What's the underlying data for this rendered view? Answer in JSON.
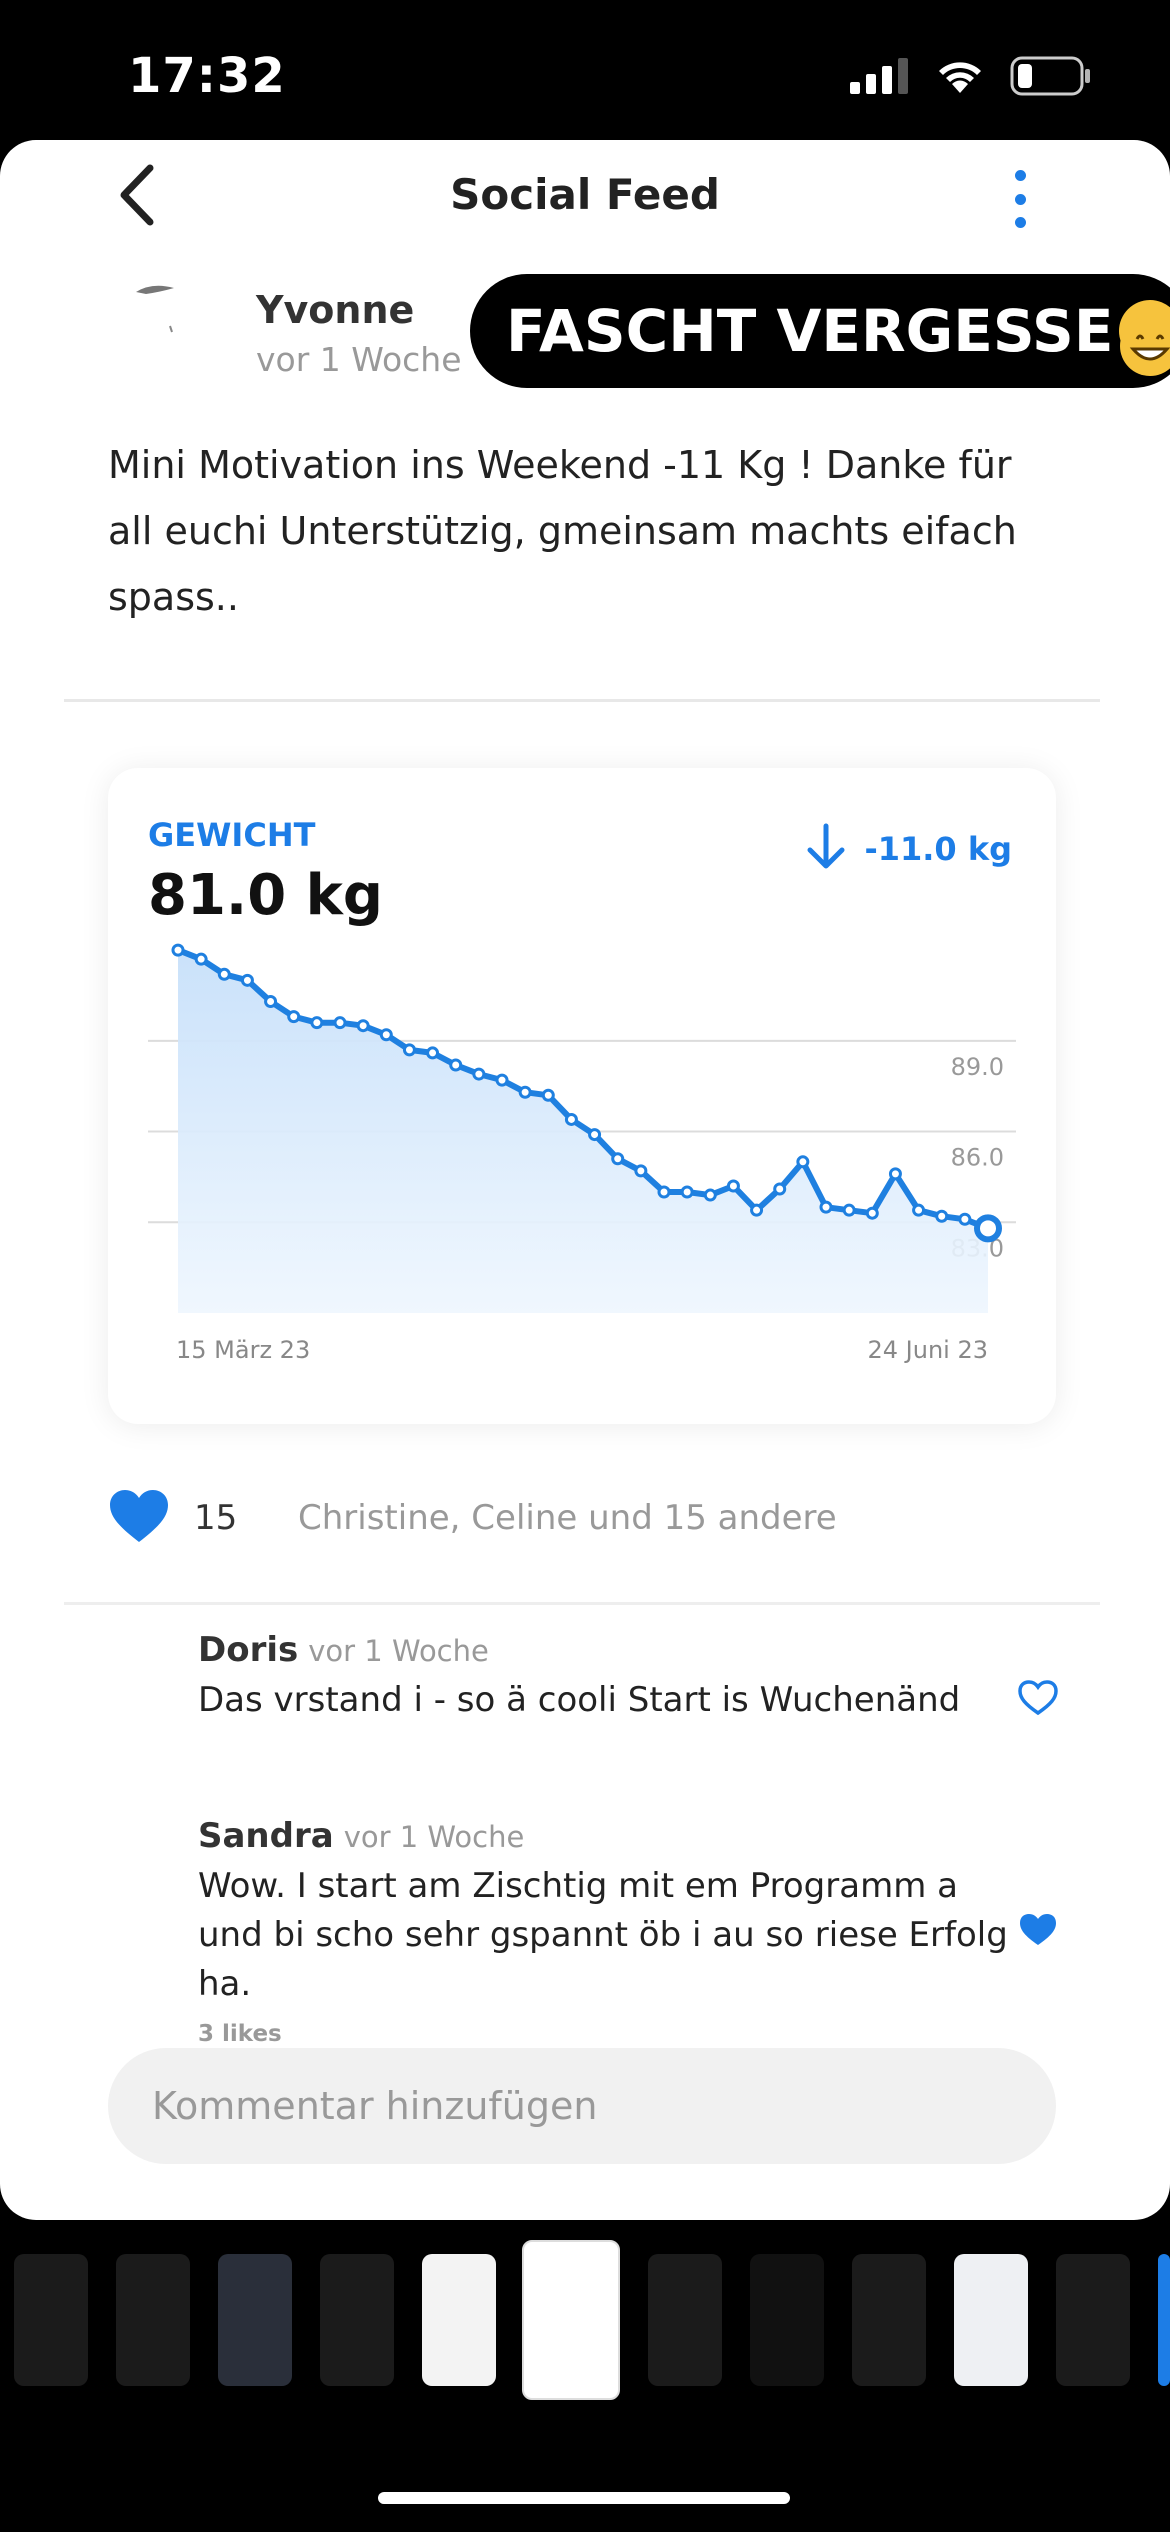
{
  "status": {
    "time": "17:32"
  },
  "nav": {
    "title": "Social Feed"
  },
  "post": {
    "author": "Yvonne",
    "time": "vor 1 Woche",
    "sticker_text": "FASCHT VERGESSE",
    "text": "Mini Motivation ins Weekend -11 Kg ! Danke  für all euchi Unterstützig, gmeinsam machts eifach spass.."
  },
  "weight_card": {
    "label": "GEWICHT",
    "current": "81.0 kg",
    "change": "-11.0 kg"
  },
  "chart_data": {
    "type": "area",
    "x_start_label": "15 März 23",
    "x_end_label": "24 Juni 23",
    "gridline_labels": [
      "89.0",
      "86.0",
      "83.0"
    ],
    "gridlines": [
      89.0,
      86.0,
      83.0
    ],
    "ylim": [
      80.0,
      92.4
    ],
    "grid": true,
    "series": [
      {
        "values": [
          92.0,
          91.7,
          91.2,
          91.0,
          90.3,
          89.8,
          89.6,
          89.6,
          89.5,
          89.2,
          88.7,
          88.6,
          88.2,
          87.9,
          87.7,
          87.3,
          87.2,
          86.4,
          85.9,
          85.1,
          84.7,
          84.0,
          84.0,
          83.9,
          84.2,
          83.4,
          84.1,
          85.0,
          83.5,
          83.4,
          83.3,
          84.6,
          83.4,
          83.2,
          83.1,
          82.8
        ]
      }
    ],
    "color": "#1f80e0"
  },
  "likes": {
    "count": "15",
    "names": "Christine, Celine und 15 andere"
  },
  "comments": [
    {
      "name": "Doris",
      "time": "vor 1 Woche",
      "text": "Das vrstand i - so ä cooli Start is Wuchenänd",
      "likes": ""
    },
    {
      "name": "Sandra",
      "time": "vor 1 Woche",
      "text": "Wow. I start am Zischtig mit em Programm a und bi scho sehr gspannt öb i au so riese Erfolg ha.",
      "likes": "3 likes"
    }
  ],
  "input": {
    "placeholder": "Kommentar hinzufügen"
  },
  "colors": {
    "accent": "#1d7de6",
    "chart_line": "#1f80e0",
    "chart_fill": "#dcecfc"
  }
}
